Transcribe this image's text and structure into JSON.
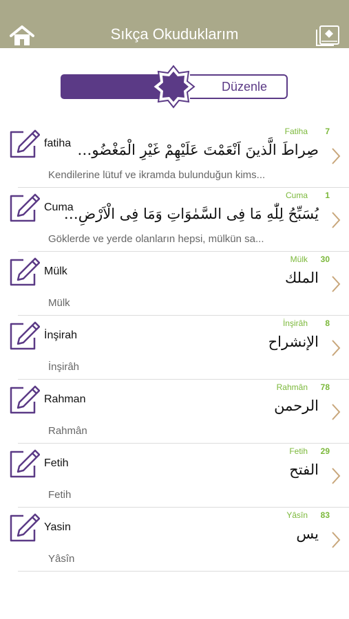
{
  "header": {
    "title": "Sıkça Okuduklarım"
  },
  "segment": {
    "edit_label": "Düzenle"
  },
  "colors": {
    "header_bg": "#aaa98a",
    "purple": "#5b3a86",
    "green": "#7bb83a",
    "chevron": "#c8a67a"
  },
  "icons": {
    "home": "home-icon",
    "book": "book-icon",
    "edit": "edit-note-icon",
    "chevron": "chevron-right-icon"
  },
  "rows": [
    {
      "name": "fatiha",
      "sura": "Fatiha",
      "count": "7",
      "arabic": "صِراطَ الَّذينَ اَنْعَمْتَ عَلَيْهِمْ غَيْرِ الْمَغْضُو…",
      "meaning": "Kendilerine lütuf ve ikramda bulunduğun kims..."
    },
    {
      "name": "Cuma",
      "sura": "Cuma",
      "count": "1",
      "arabic": "يُسَبِّحُ لِلّٰهِ مَا فِى السَّمٰوَاتِ وَمَا فِى الْاَرْضِ…",
      "meaning": "Göklerde ve yerde olanların hepsi, mülkün sa..."
    },
    {
      "name": "Mülk",
      "sura": "Mülk",
      "count": "30",
      "arabic": "الملك",
      "meaning": "Mülk"
    },
    {
      "name": "İnşirah",
      "sura": "İnşirâh",
      "count": "8",
      "arabic": "الإنشراح",
      "meaning": "İnşirâh"
    },
    {
      "name": "Rahman",
      "sura": "Rahmân",
      "count": "78",
      "arabic": "الرحمن",
      "meaning": "Rahmân"
    },
    {
      "name": "Fetih",
      "sura": "Fetih",
      "count": "29",
      "arabic": "الفتح",
      "meaning": "Fetih"
    },
    {
      "name": "Yasin",
      "sura": "Yâsîn",
      "count": "83",
      "arabic": "يس",
      "meaning": "Yâsîn"
    }
  ]
}
